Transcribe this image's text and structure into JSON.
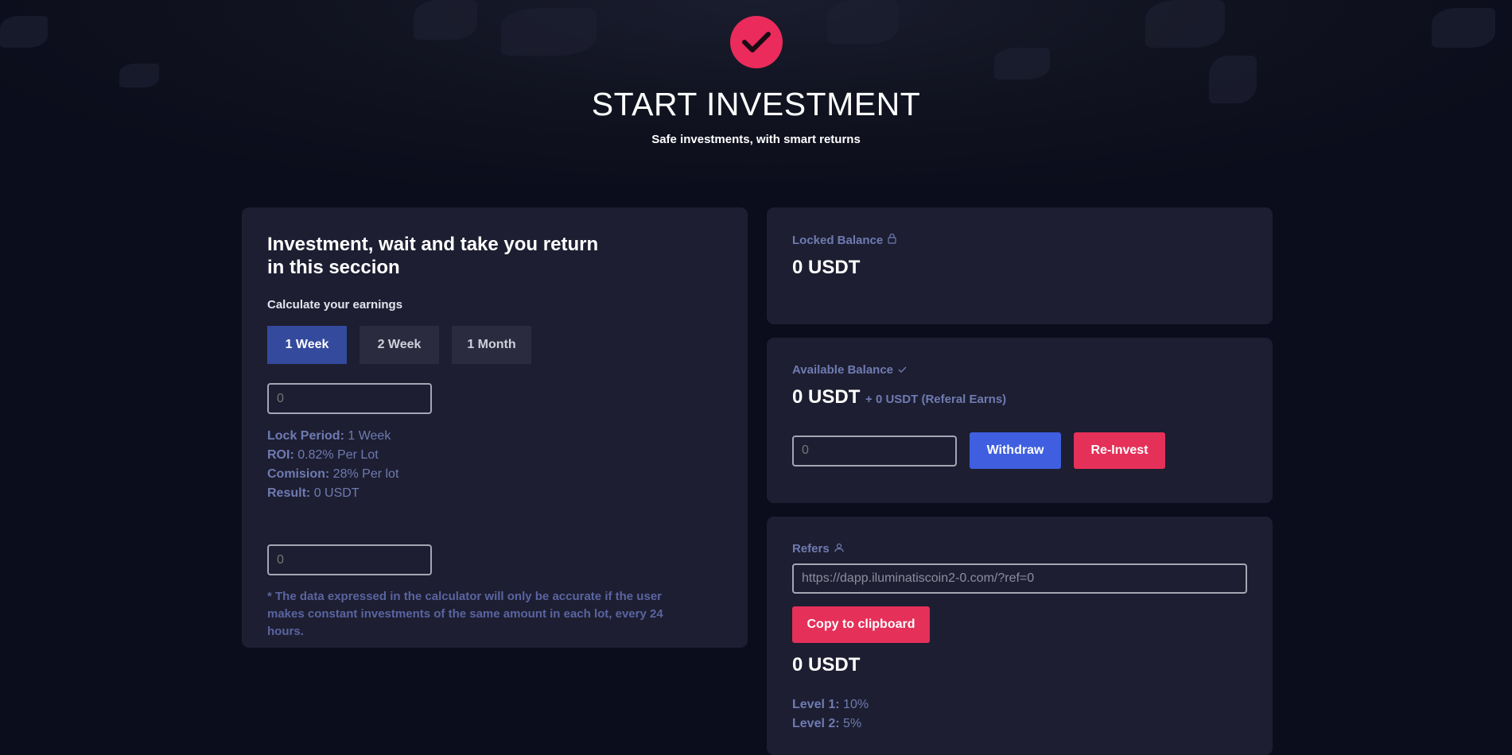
{
  "header": {
    "title": "START INVESTMENT",
    "subtitle": "Safe investments, with smart returns",
    "badge_icon": "check-icon",
    "accent": "#ea2b5b"
  },
  "calculator": {
    "heading": "Investment, wait and take you return in this seccion",
    "label": "Calculate your earnings",
    "tabs": [
      {
        "label": "1 Week",
        "active": true
      },
      {
        "label": "2 Week",
        "active": false
      },
      {
        "label": "1 Month",
        "active": false
      }
    ],
    "amount_input": {
      "placeholder": "0"
    },
    "stats": {
      "lock_period_label": "Lock Period:",
      "lock_period_value": "1 Week",
      "roi_label": "ROI:",
      "roi_value": "0.82% Per Lot",
      "comision_label": "Comision:",
      "comision_value": "28% Per lot",
      "result_label": "Result:",
      "result_value": "0 USDT"
    },
    "second_input": {
      "placeholder": "0"
    },
    "note": "* The data expressed in the calculator will only be accurate if the user makes constant investments of the same amount in each lot, every 24 hours."
  },
  "locked": {
    "label": "Locked Balance",
    "icon": "lock-icon",
    "amount": "0 USDT"
  },
  "available": {
    "label": "Available Balance",
    "icon": "check-small-icon",
    "amount": "0 USDT",
    "extra": "+ 0 USDT (Referal Earns)",
    "input_placeholder": "0",
    "withdraw_label": "Withdraw",
    "reinvest_label": "Re-Invest"
  },
  "refers": {
    "label": "Refers",
    "icon": "user-icon",
    "link_value": "https://dapp.iluminatiscoin2-0.com/?ref=0",
    "copy_label": "Copy to clipboard",
    "amount": "0 USDT",
    "level1_label": "Level 1:",
    "level1_value": "10%",
    "level2_label": "Level 2:",
    "level2_value": "5%"
  },
  "colors": {
    "background": "#0b0d1c",
    "card": "#1d1e31",
    "primary_blue": "#3f5fe0",
    "tab_active": "#344a9d",
    "danger_red": "#e53059",
    "muted_text": "#6f7bb2"
  }
}
